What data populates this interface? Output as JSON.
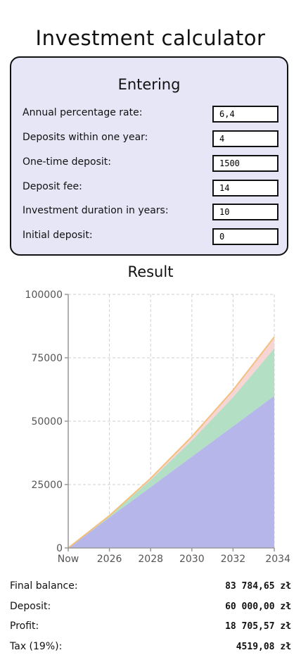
{
  "title": "Investment calculator",
  "form": {
    "heading": "Entering",
    "fields": [
      {
        "label": "Annual percentage rate:",
        "value": "6,4"
      },
      {
        "label": "Deposits within one year:",
        "value": "4"
      },
      {
        "label": "One-time deposit:",
        "value": "1500"
      },
      {
        "label": "Deposit fee:",
        "value": "14"
      },
      {
        "label": "Investment duration in years:",
        "value": "10"
      },
      {
        "label": "Initial deposit:",
        "value": "0"
      }
    ]
  },
  "result": {
    "heading": "Result",
    "summary": [
      {
        "label": "Final balance:",
        "value": "83 784,65 zł"
      },
      {
        "label": "Deposit:",
        "value": "60 000,00 zł"
      },
      {
        "label": "Profit:",
        "value": "18 705,57 zł"
      },
      {
        "label": "Tax (19%):",
        "value": "4519,08 zł"
      }
    ]
  },
  "colors": {
    "deposit": "#b6b6ea",
    "profit": "#b3dfc4",
    "tax": "#f7d5d5",
    "total_line": "#f3c07e",
    "grid": "#cfcfcf",
    "axis": "#999999"
  },
  "chart_data": {
    "type": "area",
    "stacked": true,
    "x": [
      "Now",
      "2026",
      "2028",
      "2030",
      "2032",
      "2034"
    ],
    "ylim": [
      0,
      100000
    ],
    "yticks": [
      0,
      25000,
      50000,
      75000,
      100000
    ],
    "xlabel": "",
    "ylabel": "",
    "grid": true,
    "series": [
      {
        "values": [
          0,
          12000,
          24000,
          36000,
          48000,
          60000
        ]
      },
      {
        "values": [
          0,
          600,
          2800,
          6400,
          11500,
          18700
        ]
      },
      {
        "values": [
          0,
          150,
          650,
          1550,
          2750,
          4500
        ]
      }
    ],
    "total": [
      0,
      12750,
      27450,
      43950,
      62250,
      83200
    ]
  }
}
